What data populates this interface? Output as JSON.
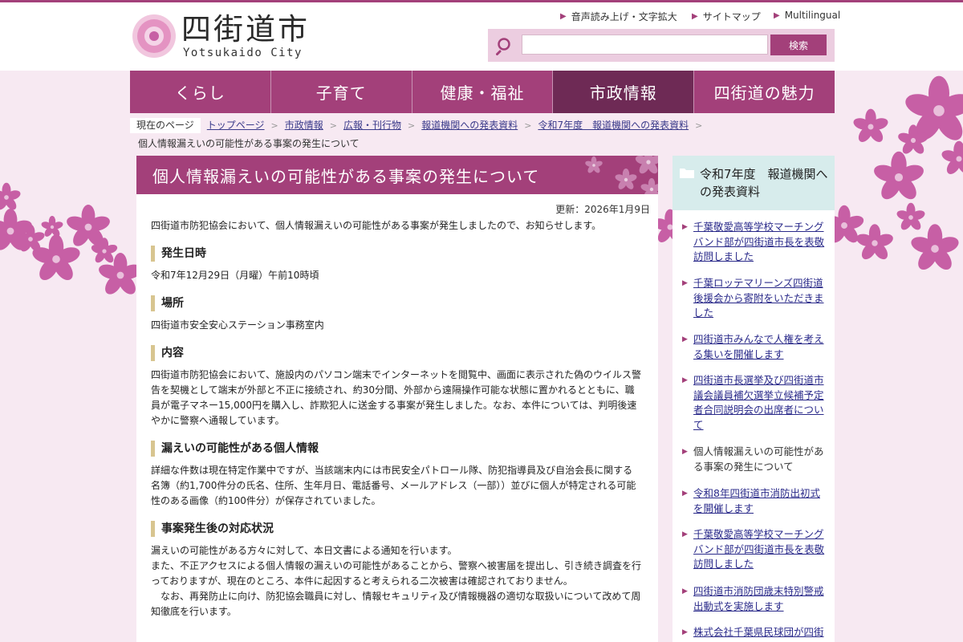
{
  "header": {
    "logo_text": "四街道市",
    "logo_sub": "Yotsukaido City",
    "utility": [
      "音声読み上げ・文字拡大",
      "サイトマップ",
      "Multilingual"
    ],
    "search": {
      "placeholder": "",
      "button": "検索"
    }
  },
  "nav": [
    {
      "label": "くらし",
      "active": false
    },
    {
      "label": "子育て",
      "active": false
    },
    {
      "label": "健康・福祉",
      "active": false
    },
    {
      "label": "市政情報",
      "active": true
    },
    {
      "label": "四街道の魅力",
      "active": false
    }
  ],
  "breadcrumb": {
    "current_label": "現在のページ",
    "links": [
      "トップページ",
      "市政情報",
      "広報・刊行物",
      "報道機関への発表資料",
      "令和7年度　報道機関への発表資料"
    ],
    "current": "個人情報漏えいの可能性がある事案の発生について"
  },
  "article": {
    "title": "個人情報漏えいの可能性がある事案の発生について",
    "updated": "更新：2026年1月9日",
    "intro": "四街道市防犯協会において、個人情報漏えいの可能性がある事案が発生しましたので、お知らせします。",
    "sections": [
      {
        "heading": "発生日時",
        "paragraphs": [
          "令和7年12月29日（月曜）午前10時頃"
        ]
      },
      {
        "heading": "場所",
        "paragraphs": [
          "四街道市安全安心ステーション事務室内"
        ]
      },
      {
        "heading": "内容",
        "paragraphs": [
          "四街道市防犯協会において、施設内のパソコン端末でインターネットを閲覧中、画面に表示された偽のウイルス警告を契機として端末が外部と不正に接続され、約30分間、外部から遠隔操作可能な状態に置かれるとともに、職員が電子マネー15,000円を購入し、詐欺犯人に送金する事案が発生しました。なお、本件については、判明後速やかに警察へ通報しています。"
        ]
      },
      {
        "heading": "漏えいの可能性がある個人情報",
        "paragraphs": [
          "詳細な件数は現在特定作業中ですが、当該端末内には市民安全パトロール隊、防犯指導員及び自治会長に関する名簿（約1,700件分の氏名、住所、生年月日、電話番号、メールアドレス（一部））並びに個人が特定される可能性のある画像（約100件分）が保存されていました。"
        ]
      },
      {
        "heading": "事案発生後の対応状況",
        "paragraphs": [
          "漏えいの可能性がある方々に対して、本日文書による通知を行います。",
          "また、不正アクセスによる個人情報の漏えいの可能性があることから、警察へ被害届を提出し、引き続き調査を行っておりますが、現在のところ、本件に起因すると考えられる二次被害は確認されておりません。",
          "　なお、再発防止に向け、防犯協会職員に対し、情報セキュリティ及び情報機器の適切な取扱いについて改めて周知徹底を行います。"
        ]
      }
    ]
  },
  "sidebar": {
    "heading": "令和7年度　報道機関への発表資料",
    "items": [
      {
        "text": "千葉敬愛高等学校マーチングバンド部が四街道市長を表敬訪問しました",
        "link": true
      },
      {
        "text": "千葉ロッテマリーンズ四街道後援会から寄附をいただきました",
        "link": true
      },
      {
        "text": "四街道市みんなで人権を考える集いを開催します",
        "link": true
      },
      {
        "text": "四街道市長選挙及び四街道市議会議員補欠選挙立候補予定者合同説明会の出席者について",
        "link": true
      },
      {
        "text": "個人情報漏えいの可能性がある事案の発生について",
        "link": false
      },
      {
        "text": "令和8年四街道市消防出初式を開催します",
        "link": true
      },
      {
        "text": "千葉敬愛高等学校マーチングバンド部が四街道市長を表敬訪問しました",
        "link": true
      },
      {
        "text": "四街道市消防団歳末特別警戒出動式を実施します",
        "link": true
      },
      {
        "text": "株式会社千葉県民球団が四街",
        "link": true
      }
    ]
  },
  "colors": {
    "accent": "#a3407a",
    "nav_active": "#6e2a55",
    "background": "#f7e9f2",
    "side_head": "#d7ecec",
    "heading_bar": "#d8c590"
  }
}
